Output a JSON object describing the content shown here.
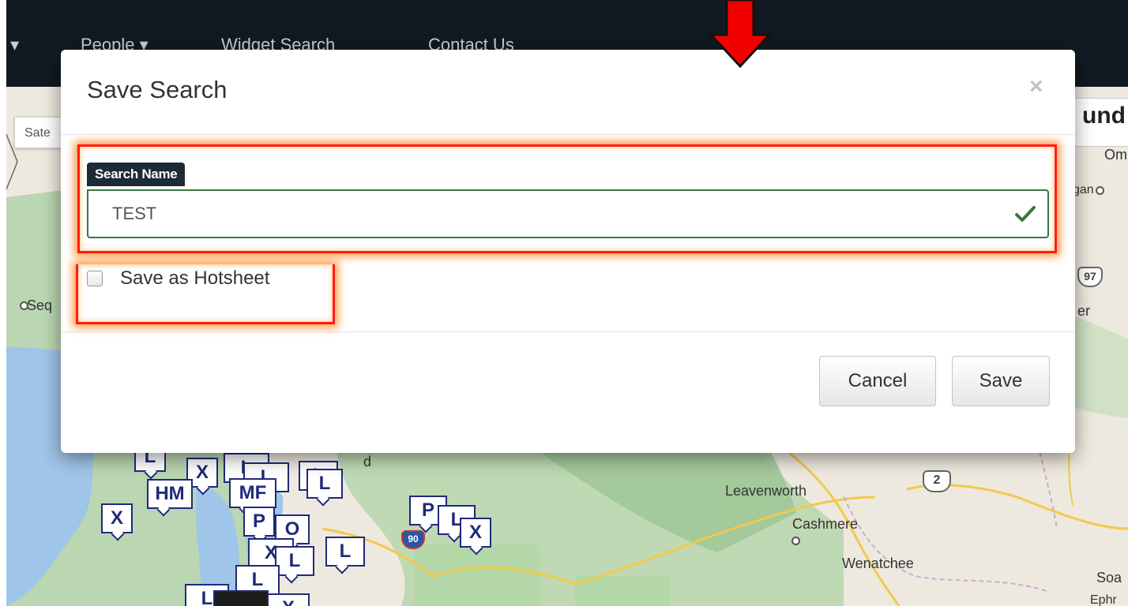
{
  "navbar": {
    "items": [
      {
        "label": "s ▾"
      },
      {
        "label": "People ▾"
      },
      {
        "label": "Widget Search"
      },
      {
        "label": "Contact Us"
      }
    ]
  },
  "map": {
    "type_button": "Sate",
    "right_panel_title": "und",
    "labels": {
      "omak": "Om",
      "okanogan": "gan",
      "seattle": "Seq",
      "leavenworth": "Leavenworth",
      "cashmere": "Cashmere",
      "wenatchee": "Wenatchee",
      "soap_lake": "Soa",
      "ephrata": "Ephr",
      "partial_er": "er",
      "partial_d": "d"
    },
    "shields": {
      "us97": "97",
      "us2": "2",
      "i90": "90"
    },
    "markers": [
      "X",
      "HM",
      "MF",
      "L",
      "X",
      "P",
      "O",
      "L",
      "X",
      "P",
      "L",
      "X",
      "L",
      "X",
      "X",
      "L",
      "L",
      "L",
      "L",
      "L",
      "L"
    ]
  },
  "modal": {
    "title": "Save Search",
    "close_glyph": "×",
    "search_name_label": "Search Name",
    "search_name_value": "TEST",
    "hotsheet_label": "Save as Hotsheet",
    "hotsheet_checked": false,
    "cancel_label": "Cancel",
    "save_label": "Save"
  },
  "annotation": {
    "color": "#ff1a1a",
    "glow": "#ff8c00"
  }
}
